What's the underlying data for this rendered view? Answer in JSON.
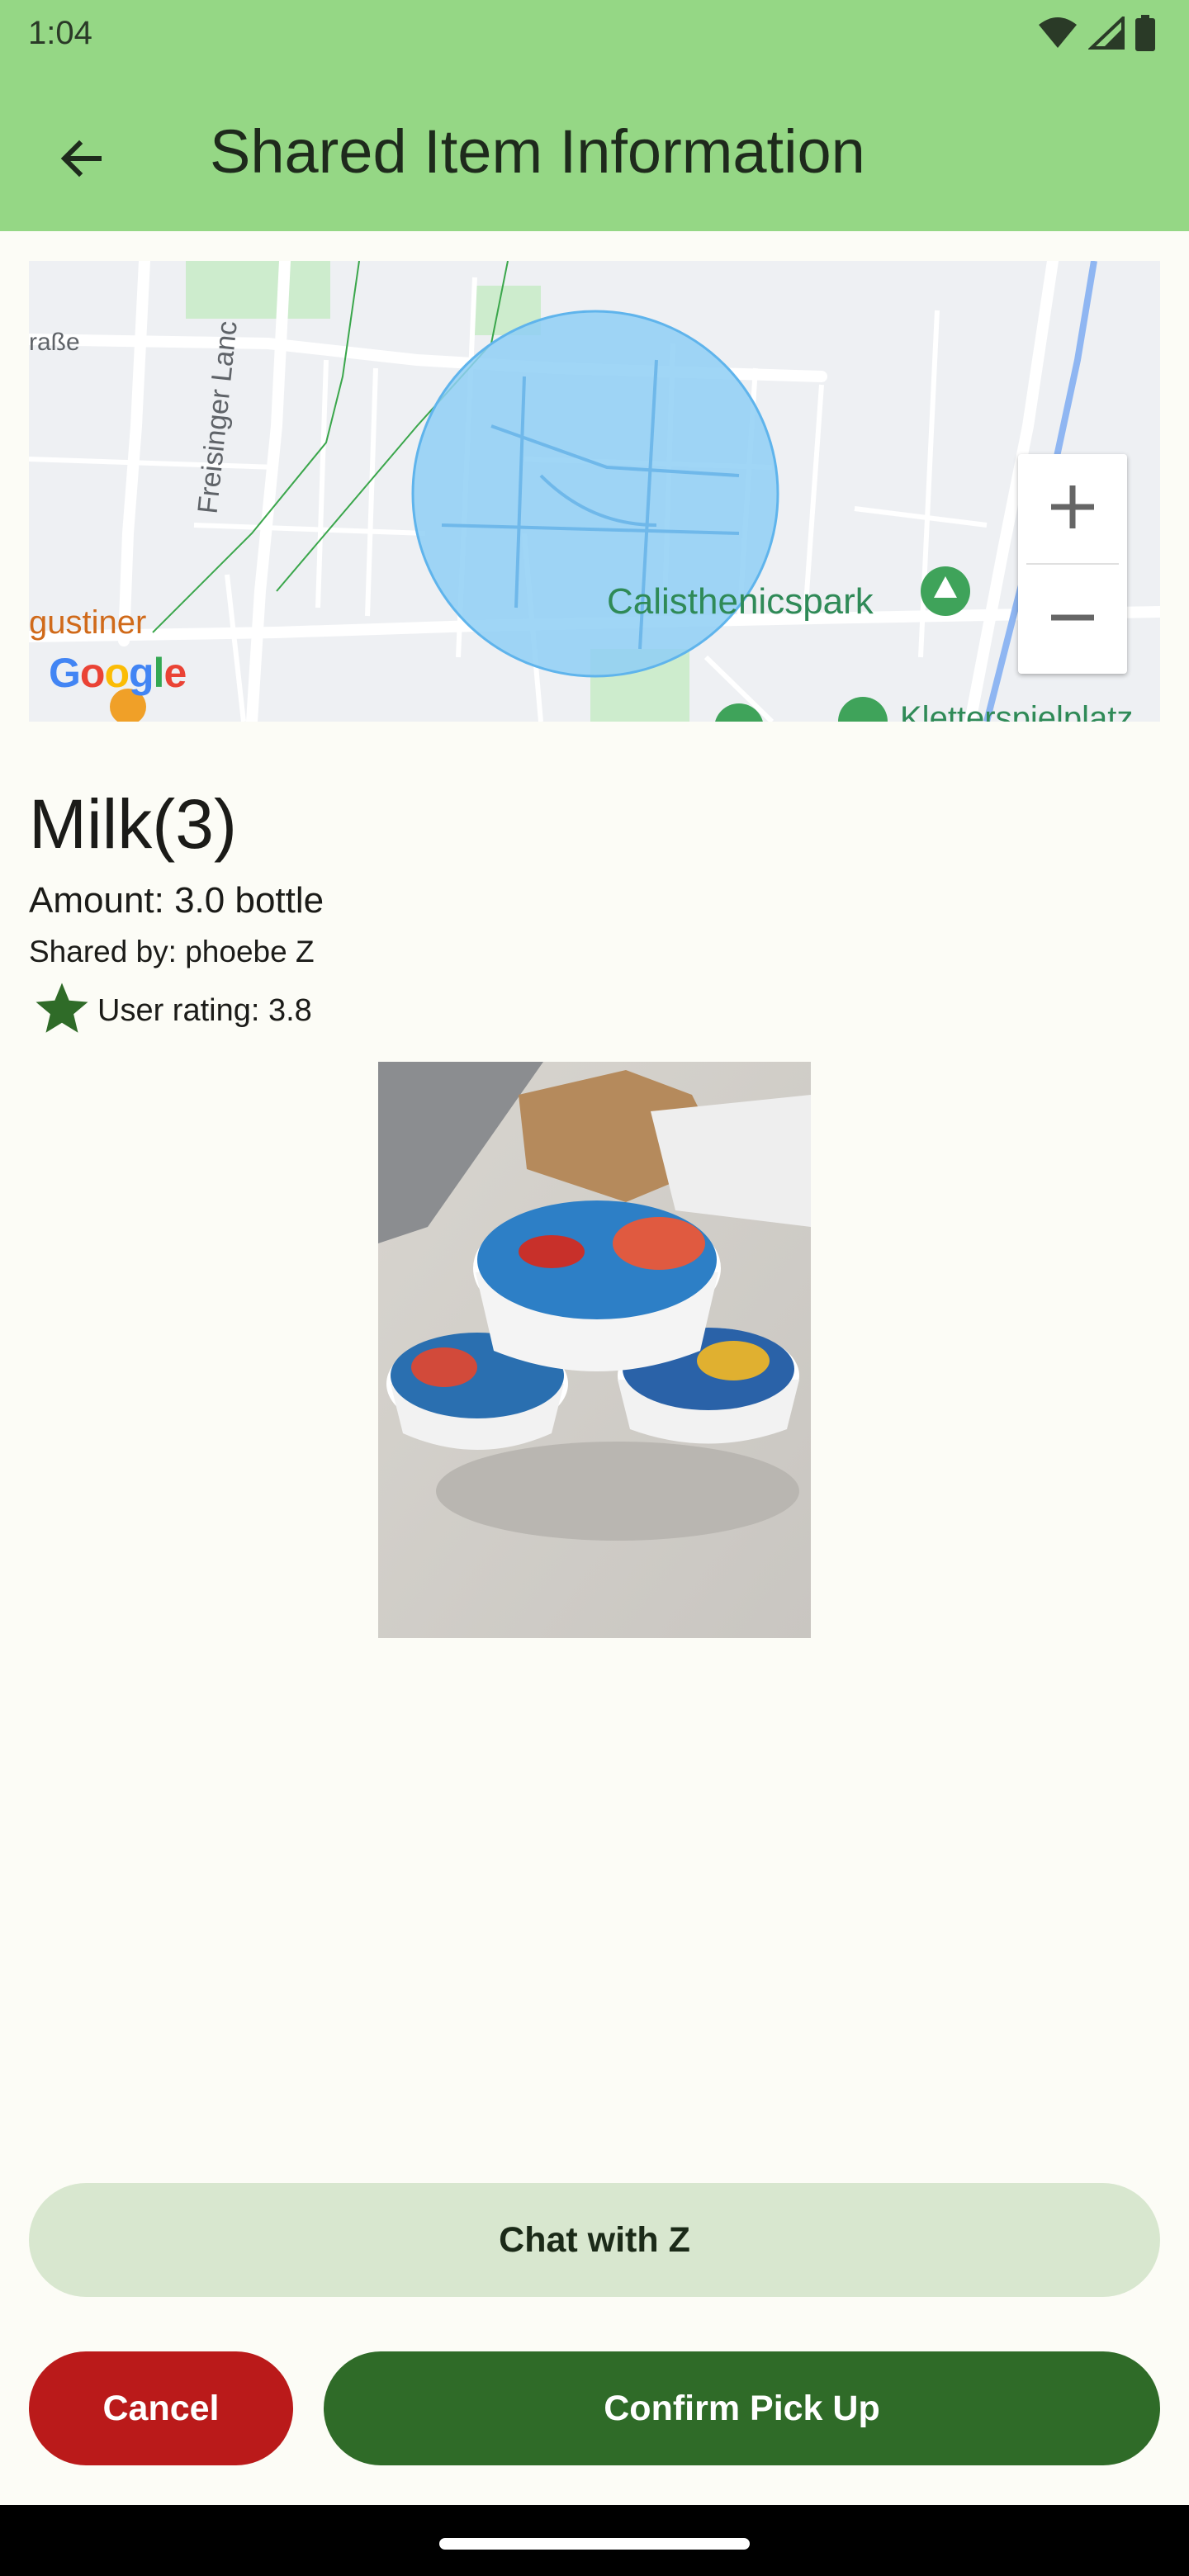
{
  "status_bar": {
    "time": "1:04",
    "icons": [
      "wifi-icon",
      "cellular-signal-icon",
      "battery-icon"
    ]
  },
  "app_bar": {
    "title": "Shared Item Information",
    "back_icon": "arrow-back-icon",
    "background": "#95d785"
  },
  "map": {
    "labels": {
      "street_left": "raße",
      "freisinger": "Freisinger Lanc",
      "augustiner": "gustiner",
      "calisthenics": "Calisthenicspark",
      "kletter": "Kletterspielplatz"
    },
    "logo": "Google",
    "zoom_in_label": "+",
    "zoom_out_label": "−",
    "circle_color": "#8fcff5"
  },
  "item": {
    "title": "Milk(3)",
    "amount": "Amount: 3.0 bottle",
    "shared_by": "Shared by: phoebe Z",
    "rating": "User rating: 3.8",
    "rating_icon": "star-icon"
  },
  "actions": {
    "chat_label": "Chat with Z",
    "cancel_label": "Cancel",
    "confirm_label": "Confirm Pick Up"
  },
  "colors": {
    "accent_green": "#2f6b28",
    "danger_red": "#ba1a1a",
    "chat_bg": "#d8e7cf",
    "page_bg": "#fcfcf6"
  }
}
